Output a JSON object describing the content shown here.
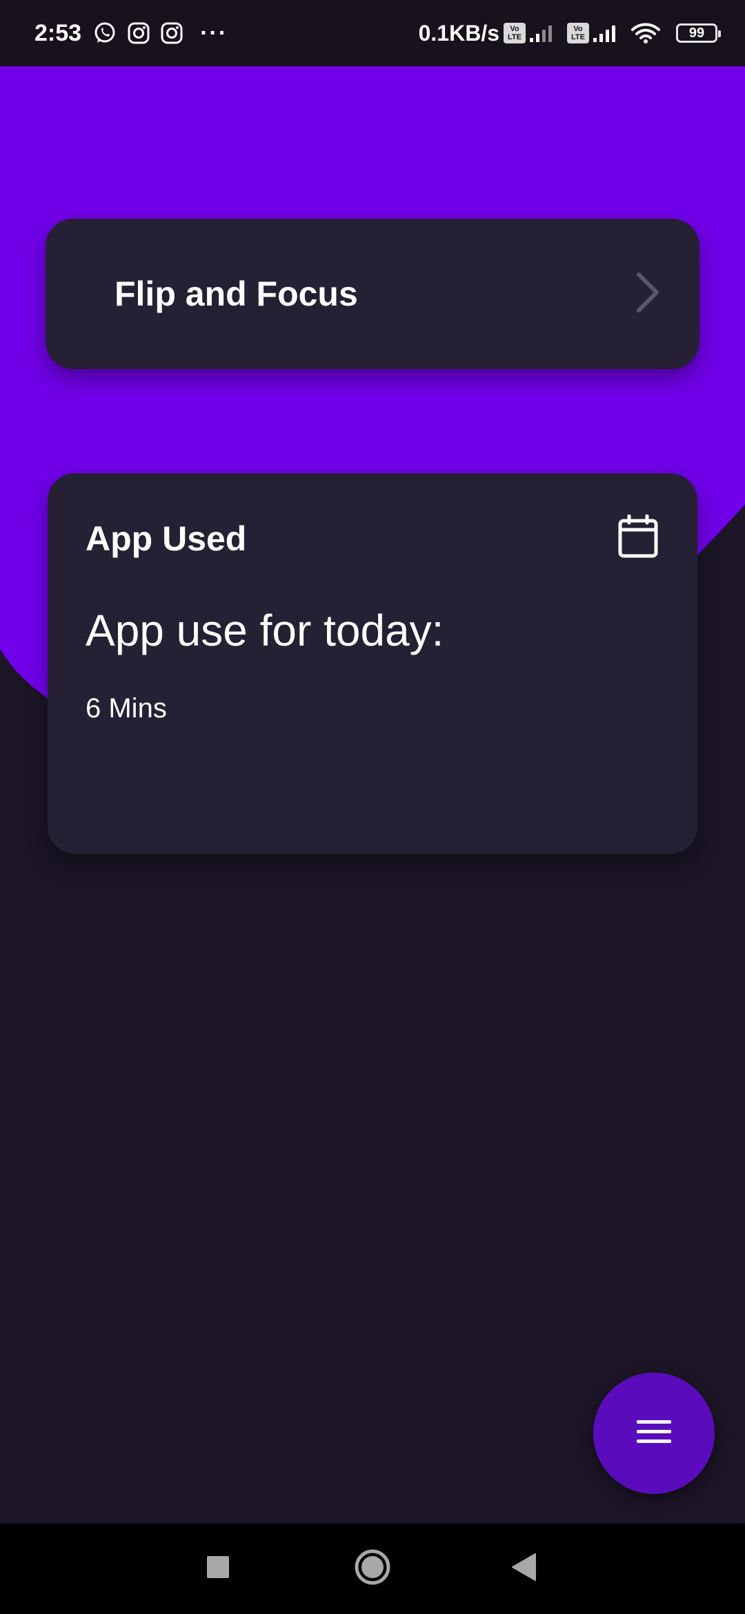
{
  "status_bar": {
    "time": "2:53",
    "dots": "···",
    "net_speed": "0.1KB/s",
    "volte_top": "Vo",
    "volte_bottom": "LTE",
    "battery": "99",
    "notification_icons": [
      "whatsapp-icon",
      "instagram-icon",
      "instagram-icon"
    ],
    "system_icons": [
      "volte-icon",
      "signal-icon",
      "volte-icon",
      "signal-icon",
      "wifi-icon",
      "battery-icon"
    ]
  },
  "flip_card": {
    "title": "Flip and Focus",
    "icon": "chevron-right-icon"
  },
  "usage_card": {
    "title": "App Used",
    "icon": "calendar-icon",
    "subtitle": "App use for today:",
    "value": "6 Mins"
  },
  "fab": {
    "icon": "menu-icon"
  },
  "nav_bar": {
    "icons": [
      "recents-icon",
      "home-icon",
      "back-icon"
    ]
  },
  "colors": {
    "background": "#1b1526",
    "accent_purple": "#7000e8",
    "card": "#252033",
    "fab": "#5a0cbd",
    "status_bar": "#17121c",
    "nav_bar": "#000000"
  }
}
